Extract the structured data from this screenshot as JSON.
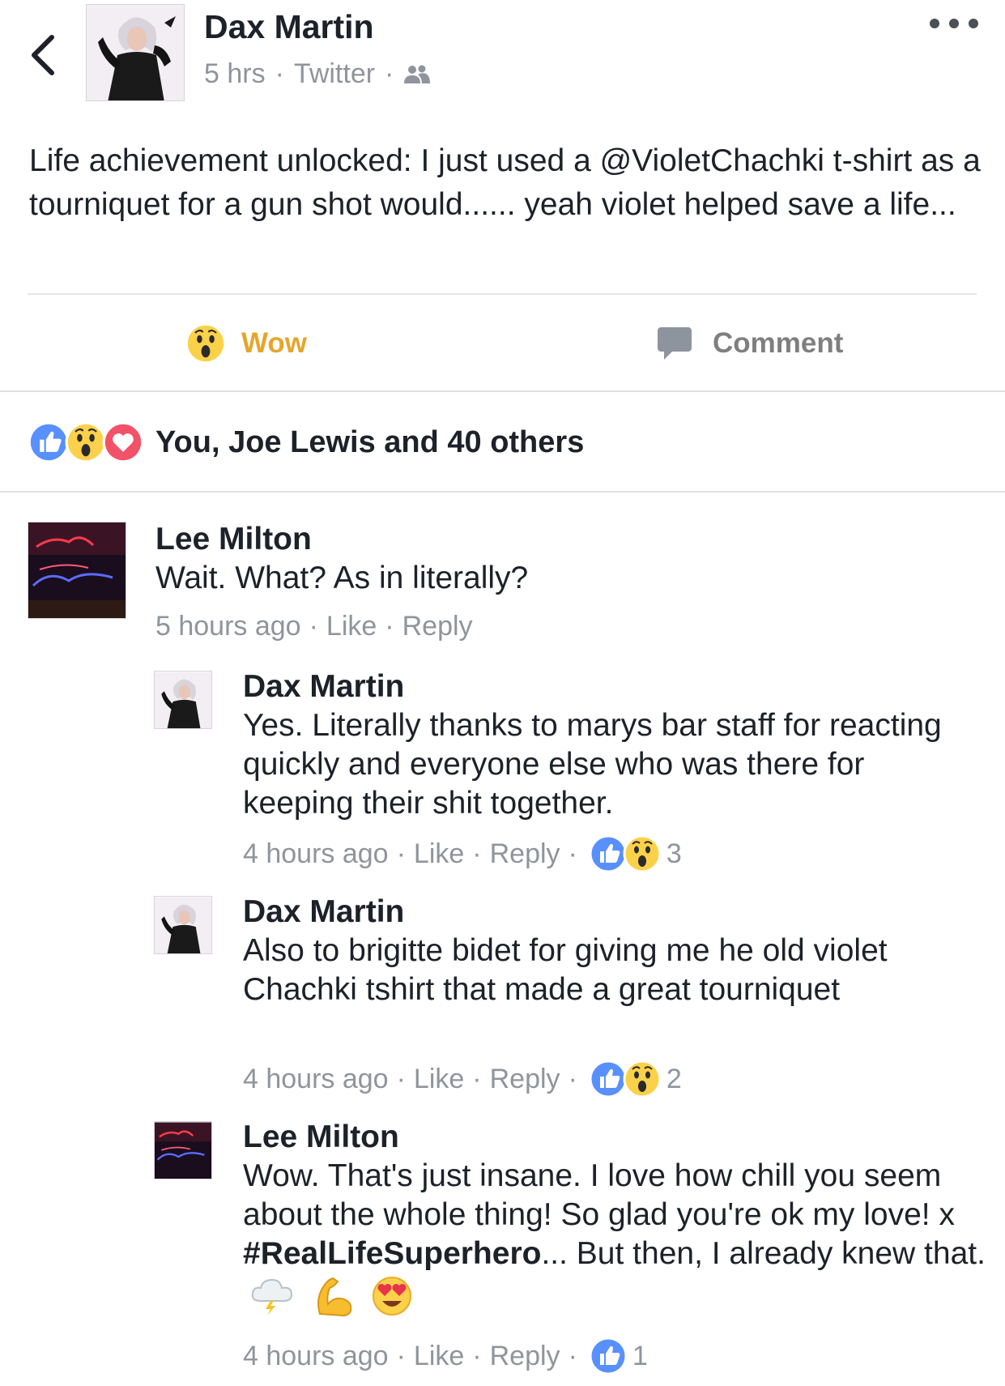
{
  "post": {
    "author": "Dax Martin",
    "time": "5 hrs",
    "source": "Twitter",
    "audience_icon": "friends-icon",
    "text": "Life achievement unlocked: I just used a @VioletChachki t-shirt as a tourniquet for a gun shot would...... yeah violet helped save a life..."
  },
  "actions": {
    "reaction_label": "Wow",
    "comment_label": "Comment"
  },
  "reactions_summary": {
    "icons": [
      "like-icon",
      "wow-icon",
      "love-icon"
    ],
    "text": "You, Joe Lewis and 40 others"
  },
  "comments": [
    {
      "author": "Lee Milton",
      "text": "Wait. What? As in literally?",
      "time": "5 hours ago",
      "like": "Like",
      "reply": "Reply"
    },
    {
      "author": "Dax Martin",
      "text": "Yes. Literally thanks to marys bar staff for reacting quickly and everyone else who was there for keeping their shit together.",
      "time": "4 hours ago",
      "like": "Like",
      "reply": "Reply",
      "reaction_count": "3"
    },
    {
      "author": "Dax Martin",
      "text": "Also to brigitte bidet for giving me he old violet Chachki tshirt that made a great tourniquet",
      "time": "4 hours ago",
      "like": "Like",
      "reply": "Reply",
      "reaction_count": "2"
    },
    {
      "author": "Lee Milton",
      "text_before": "Wow. That's just insane. I love how chill you seem about the whole thing! So glad you're ok my love! x ",
      "hashtag": "#RealLifeSuperhero",
      "text_after": "... But then, I already knew that.",
      "emojis": [
        "cloud-lightning-icon",
        "flexed-biceps-icon",
        "heart-eyes-icon"
      ],
      "time": "4 hours ago",
      "like": "Like",
      "reply": "Reply",
      "reaction_count": "1"
    }
  ],
  "colors": {
    "wow_yellow": "#e4a62d",
    "like_blue": "#5890ff",
    "love_red": "#f25268",
    "meta_gray": "#90949c"
  }
}
